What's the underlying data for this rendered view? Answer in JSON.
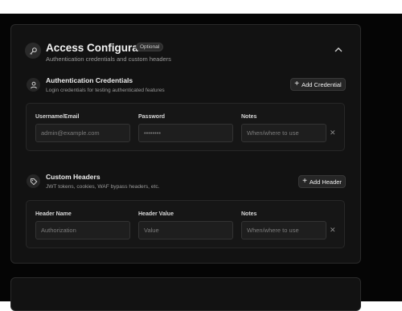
{
  "header": {
    "title": "Access Configuration",
    "badge": "Optional",
    "subtitle": "Authentication credentials and custom headers"
  },
  "auth": {
    "title": "Authentication Credentials",
    "subtitle": "Login credentials for testing authenticated features",
    "add_button": "Add Credential",
    "columns": [
      "Username/Email",
      "Password",
      "Notes"
    ],
    "row": {
      "username_placeholder": "admin@example.com",
      "password_placeholder": "••••••••",
      "notes_placeholder": "When/where to use",
      "remove": "✕"
    }
  },
  "headers": {
    "title": "Custom Headers",
    "subtitle": "JWT tokens, cookies, WAF bypass headers, etc.",
    "add_button": "Add Header",
    "columns": [
      "Header Name",
      "Header Value",
      "Notes"
    ],
    "row": {
      "name_placeholder": "Authorization",
      "value_placeholder": "Value",
      "notes_placeholder": "When/where to use",
      "remove": "✕"
    }
  },
  "icons": {
    "header": "key-icon",
    "auth": "user-icon",
    "headers": "tag-icon",
    "collapse": "chevron-up-icon",
    "add": "plus-icon",
    "remove": "close-icon"
  }
}
